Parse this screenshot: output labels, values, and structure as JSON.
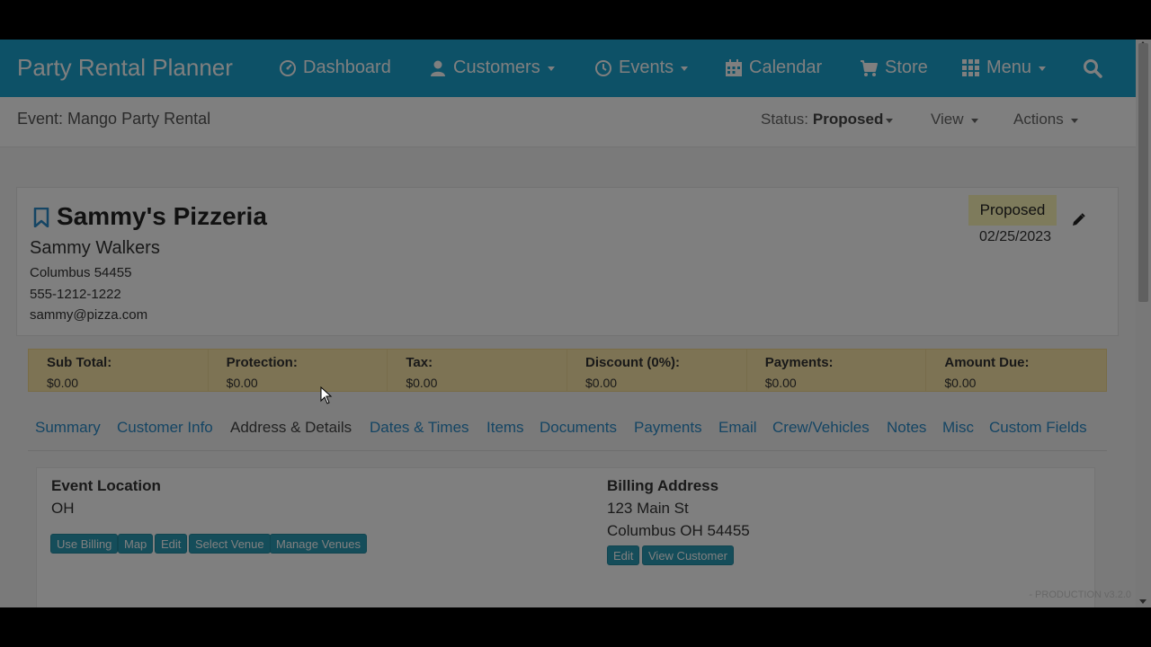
{
  "navbar": {
    "brand": "Party Rental Planner",
    "items": [
      {
        "label": "Dashboard",
        "icon": "dashboard-icon"
      },
      {
        "label": "Customers",
        "icon": "user-icon"
      },
      {
        "label": "Events",
        "icon": "clock-icon"
      },
      {
        "label": "Calendar",
        "icon": "calendar-icon"
      },
      {
        "label": "Store",
        "icon": "cart-icon"
      },
      {
        "label": "Menu",
        "icon": "grid-icon"
      }
    ],
    "search_icon": "search-icon",
    "color": "#1aa3cf"
  },
  "subheader": {
    "title": "Event: Mango Party Rental",
    "status_label": "Status:",
    "status_value": "Proposed",
    "view_label": "View",
    "actions_label": "Actions"
  },
  "card": {
    "customer_name": "Sammy's Pizzeria",
    "contact_name": "Sammy Walkers",
    "city_zip": "Columbus 54455",
    "phone": "555-1212-1222",
    "email": "sammy@pizza.com",
    "status": "Proposed",
    "date": "02/25/2023"
  },
  "totals": [
    {
      "label": "Sub Total:",
      "value": "$0.00"
    },
    {
      "label": "Protection:",
      "value": "$0.00"
    },
    {
      "label": "Tax:",
      "value": "$0.00"
    },
    {
      "label": "Discount (0%):",
      "value": "$0.00"
    },
    {
      "label": "Payments:",
      "value": "$0.00"
    },
    {
      "label": "Amount Due:",
      "value": "$0.00"
    }
  ],
  "tabs": [
    {
      "label": "Summary"
    },
    {
      "label": "Customer Info"
    },
    {
      "label": "Address & Details",
      "active": true
    },
    {
      "label": "Dates & Times"
    },
    {
      "label": "Items"
    },
    {
      "label": "Documents"
    },
    {
      "label": "Payments"
    },
    {
      "label": "Email"
    },
    {
      "label": "Crew/Vehicles"
    },
    {
      "label": "Notes"
    },
    {
      "label": "Misc"
    },
    {
      "label": "Custom Fields"
    }
  ],
  "event_location": {
    "heading": "Event Location",
    "state": "OH",
    "buttons": [
      "Use Billing",
      "Map",
      "Edit",
      "Select Venue",
      "Manage Venues"
    ]
  },
  "billing_address": {
    "heading": "Billing Address",
    "street": "123 Main St",
    "city_line": "Columbus OH 54455",
    "buttons": [
      "Edit",
      "View Customer"
    ]
  },
  "footer": {
    "version": "- PRODUCTION v3.2.0"
  }
}
